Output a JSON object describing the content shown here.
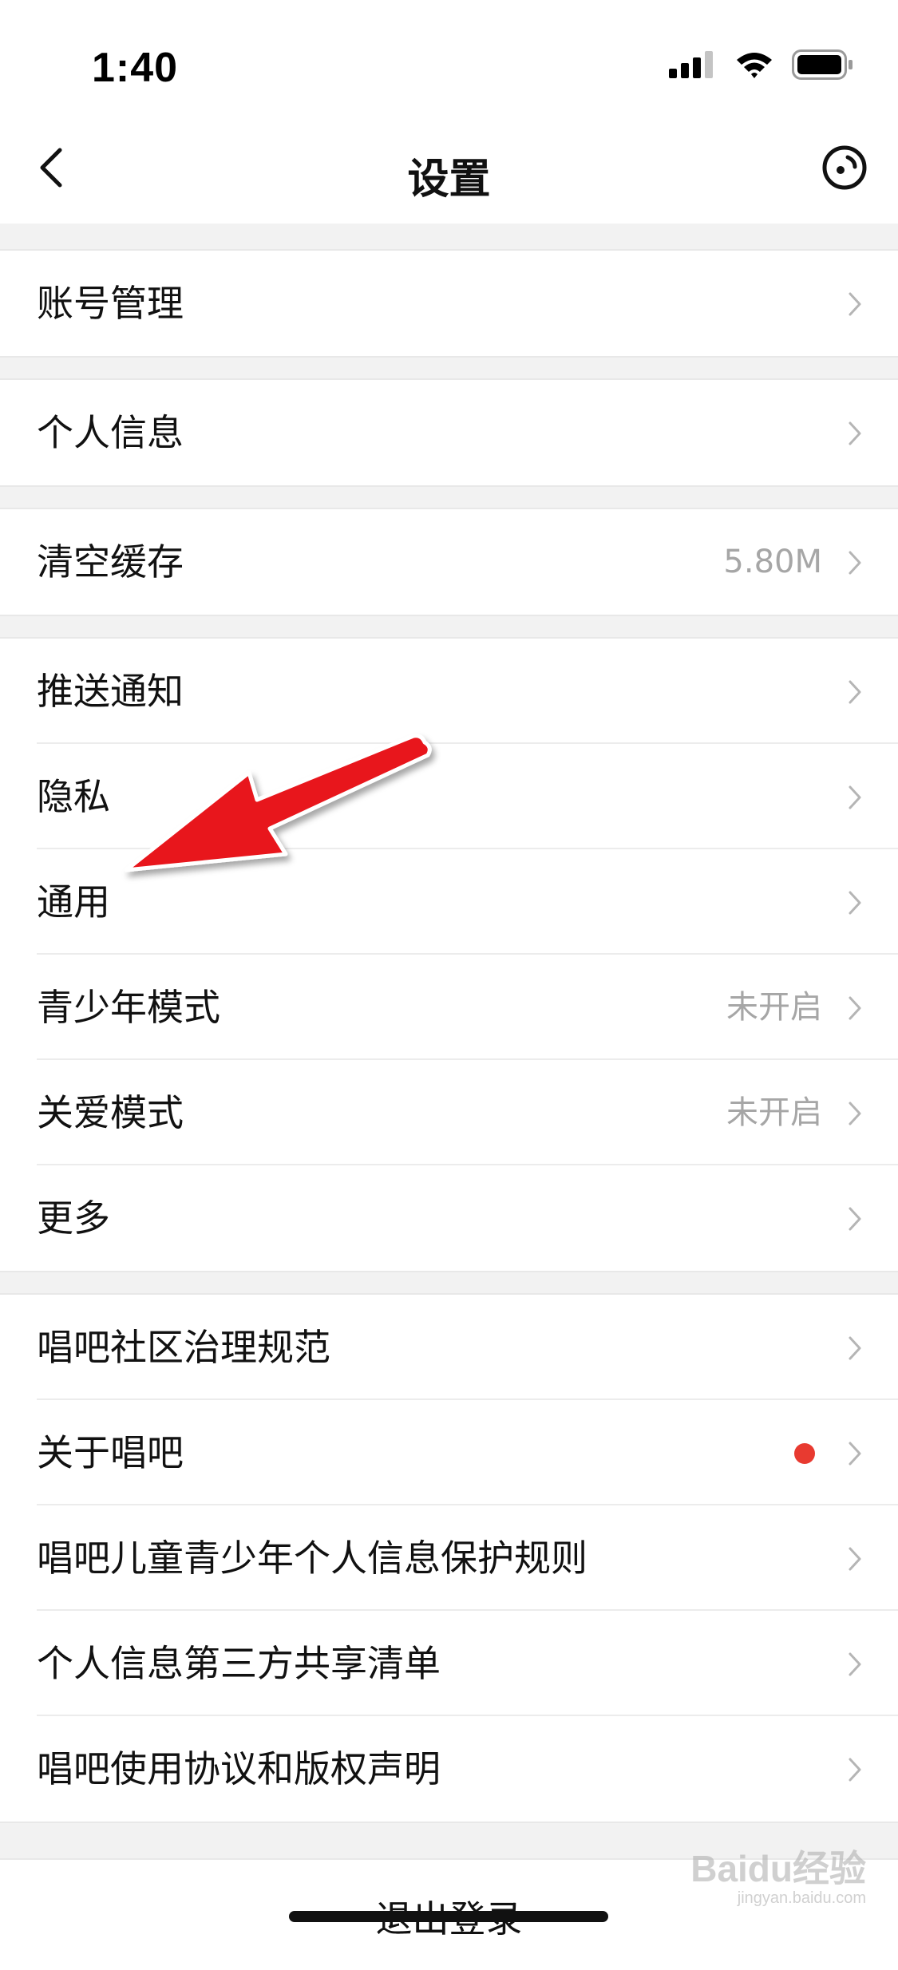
{
  "status_bar": {
    "time": "1:40",
    "icons": [
      "signal-icon",
      "wifi-icon",
      "battery-icon"
    ]
  },
  "nav": {
    "title": "设置",
    "back_icon": "chevron-left-icon",
    "action_icon": "circle-dot-icon"
  },
  "groups": [
    {
      "items": [
        {
          "label": "账号管理",
          "value": ""
        }
      ]
    },
    {
      "items": [
        {
          "label": "个人信息",
          "value": ""
        }
      ]
    },
    {
      "items": [
        {
          "label": "清空缓存",
          "value": "5.80M"
        }
      ]
    },
    {
      "items": [
        {
          "label": "推送通知",
          "value": ""
        },
        {
          "label": "隐私",
          "value": ""
        },
        {
          "label": "通用",
          "value": ""
        },
        {
          "label": "青少年模式",
          "value": "未开启"
        },
        {
          "label": "关爱模式",
          "value": "未开启"
        },
        {
          "label": "更多",
          "value": ""
        }
      ]
    },
    {
      "items": [
        {
          "label": "唱吧社区治理规范",
          "value": ""
        },
        {
          "label": "关于唱吧",
          "value": "",
          "badge": "red-dot"
        },
        {
          "label": "唱吧儿童青少年个人信息保护规则",
          "value": ""
        },
        {
          "label": "个人信息第三方共享清单",
          "value": ""
        },
        {
          "label": "唱吧使用协议和版权声明",
          "value": ""
        }
      ]
    }
  ],
  "logout": {
    "label": "退出登录"
  },
  "watermark": {
    "text": "Baidu经验",
    "subtext": "jingyan.baidu.com"
  },
  "colors": {
    "background": "#f2f2f2",
    "surface": "#ffffff",
    "secondary_text": "#a6a6a6",
    "badge": "#e83a30",
    "annotation_arrow": "#e8121a"
  }
}
